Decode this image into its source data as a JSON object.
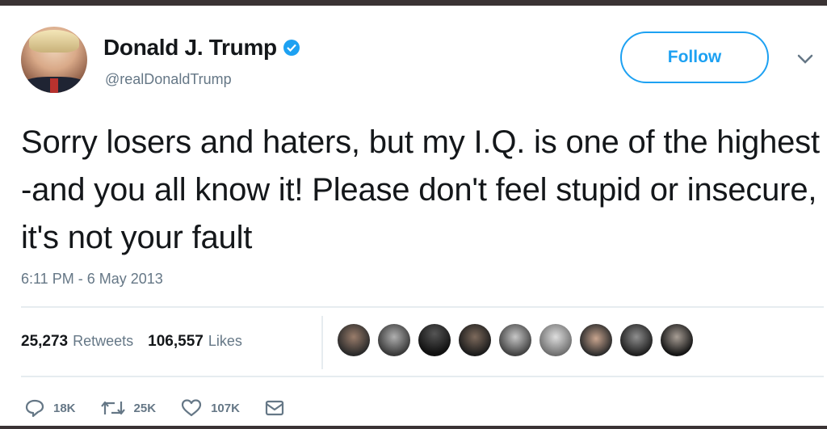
{
  "user": {
    "display_name": "Donald J. Trump",
    "handle": "@realDonaldTrump",
    "verified": true
  },
  "header": {
    "follow_label": "Follow"
  },
  "tweet": {
    "text": "Sorry losers and haters, but my I.Q. is one of the highest -and you all know it! Please don't feel stupid or insecure, it's not your fault",
    "timestamp": "6:11 PM - 6 May 2013"
  },
  "stats": {
    "retweets_count": "25,273",
    "retweets_label": "Retweets",
    "likes_count": "106,557",
    "likes_label": "Likes"
  },
  "actions": {
    "reply_count": "18K",
    "retweet_count": "25K",
    "like_count": "107K"
  },
  "icons": [
    "verified-icon",
    "chevron-down-icon",
    "reply-icon",
    "retweet-icon",
    "like-icon",
    "message-icon"
  ],
  "colors": {
    "accent": "#1da1f2",
    "text": "#14171a",
    "muted": "#657786",
    "divider": "#e6ecf0",
    "frame": "#3a3334"
  }
}
